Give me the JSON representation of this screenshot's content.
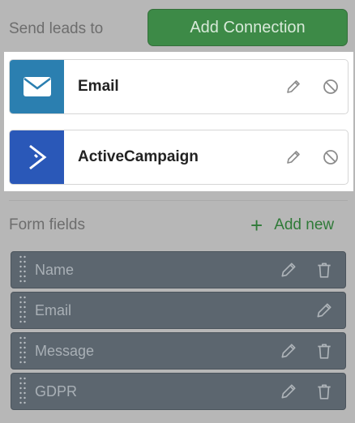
{
  "send_leads": {
    "title": "Send leads to",
    "add_connection_label": "Add Connection"
  },
  "connections": [
    {
      "name": "Email",
      "icon": "envelope-icon",
      "color": "#2b7fb0"
    },
    {
      "name": "ActiveCampaign",
      "icon": "activecampaign-logo-icon",
      "color": "#2a58b8"
    }
  ],
  "form_fields": {
    "title": "Form fields",
    "add_new_label": "Add new",
    "items": [
      {
        "label": "Name",
        "deletable": true
      },
      {
        "label": "Email",
        "deletable": false
      },
      {
        "label": "Message",
        "deletable": true
      },
      {
        "label": "GDPR",
        "deletable": true
      }
    ]
  },
  "colors": {
    "overlay_background": "#b7b7b7",
    "accent_green": "#3d8a47",
    "field_row": "#5c666f"
  }
}
